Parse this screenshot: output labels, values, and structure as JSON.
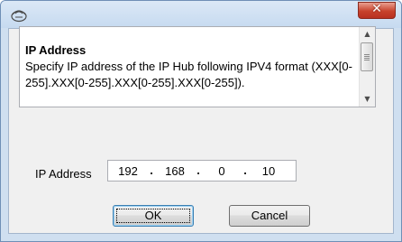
{
  "window": {
    "icon": "app-logo-icon",
    "close_glyph": "✕"
  },
  "description": {
    "title": "IP Address",
    "body": "Specify IP address of the IP Hub following IPV4 format (XXX[0-255].XXX[0-255].XXX[0-255].XXX[0-255])."
  },
  "ip": {
    "label": "IP Address",
    "octets": [
      "192",
      "168",
      "0",
      "10"
    ],
    "separator": "."
  },
  "buttons": {
    "ok": "OK",
    "cancel": "Cancel"
  },
  "scrollbar": {
    "up_glyph": "▲",
    "down_glyph": "▼"
  },
  "colors": {
    "close_button": "#c7422c",
    "default_button_border": "#3c7fb1"
  }
}
